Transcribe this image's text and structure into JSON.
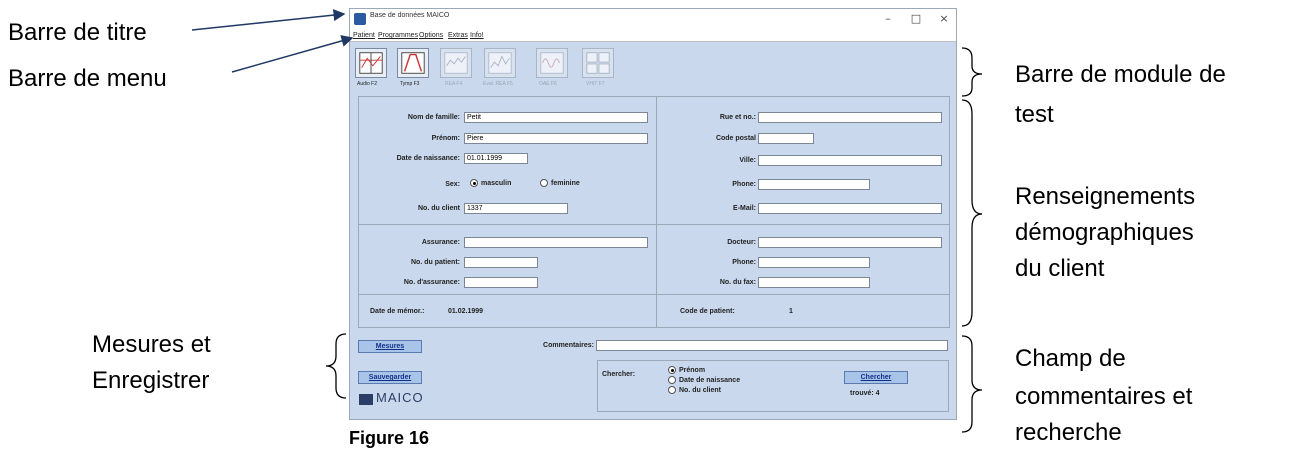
{
  "callouts": {
    "title_bar": "Barre de titre",
    "menu_bar": "Barre de menu",
    "test_module_bar_line1": "Barre de module de",
    "test_module_bar_line2": "test",
    "demographics_line1": "Renseignements",
    "demographics_line2": "démographiques",
    "demographics_line3": "du client",
    "measures_line1": "Mesures et",
    "measures_line2": "Enregistrer",
    "comments_line1": "Champ de",
    "comments_line2": "commentaires et",
    "comments_line3": "recherche"
  },
  "window": {
    "title": "Base de données MAICO",
    "controls": {
      "minimize": "–",
      "maximize": "□",
      "close": "×"
    }
  },
  "menu": [
    "Patient",
    "Programmes",
    "Options",
    "Extras",
    "Info!"
  ],
  "toolbar": [
    {
      "label": "Audio F2",
      "icon": "audio-icon",
      "enabled": true
    },
    {
      "label": "Tymp F3",
      "icon": "tymp-icon",
      "enabled": true
    },
    {
      "label": "REA F4",
      "icon": "rea-icon",
      "enabled": false
    },
    {
      "label": "Eval. REA F5",
      "icon": "eval-rea-icon",
      "enabled": false
    },
    {
      "label": "OAE F6",
      "icon": "oae-icon",
      "enabled": false
    },
    {
      "label": "VHIT F7",
      "icon": "vhit-icon",
      "enabled": false
    }
  ],
  "patient": {
    "nom_label": "Nom de famille:",
    "nom_value": "Petit",
    "prenom_label": "Prénom:",
    "prenom_value": "Piere",
    "dob_label": "Date de naissance:",
    "dob_value": "01.01.1999",
    "sex_label": "Sex:",
    "sex_male": "masculin",
    "sex_female": "feminine",
    "sex_selected": "masculin",
    "client_no_label": "No. du client",
    "client_no_value": "1337",
    "rue_label": "Rue et no.:",
    "rue_value": "",
    "cp_label": "Code postal",
    "cp_value": "",
    "ville_label": "Ville:",
    "ville_value": "",
    "phone_label": "Phone:",
    "phone_value": "",
    "email_label": "E-Mail:",
    "email_value": ""
  },
  "insurance": {
    "assurance_label": "Assurance:",
    "assurance_value": "",
    "patient_no_label": "No. du patient:",
    "patient_no_value": "",
    "assurance_no_label": "No. d'assurance:",
    "assurance_no_value": "",
    "docteur_label": "Docteur:",
    "docteur_value": "",
    "phone_label": "Phone:",
    "phone_value": "",
    "fax_label": "No. du fax:",
    "fax_value": ""
  },
  "footer": {
    "memo_label": "Date de mémor.:",
    "memo_value": "01.02.1999",
    "patient_code_label": "Code de patient:",
    "patient_code_value": "1"
  },
  "actions": {
    "measures_button": "Mesures",
    "save_button": "Sauvegarder",
    "comments_label": "Commentaires:",
    "comments_value": "",
    "search_label": "Chercher:",
    "search_options": [
      "Prénom",
      "Date de naissance",
      "No. du client"
    ],
    "search_selected": "Prénom",
    "search_button": "Chercher",
    "found_text": "trouvé: 4",
    "logo_text": "MAICO"
  },
  "figure_caption": "Figure 16"
}
